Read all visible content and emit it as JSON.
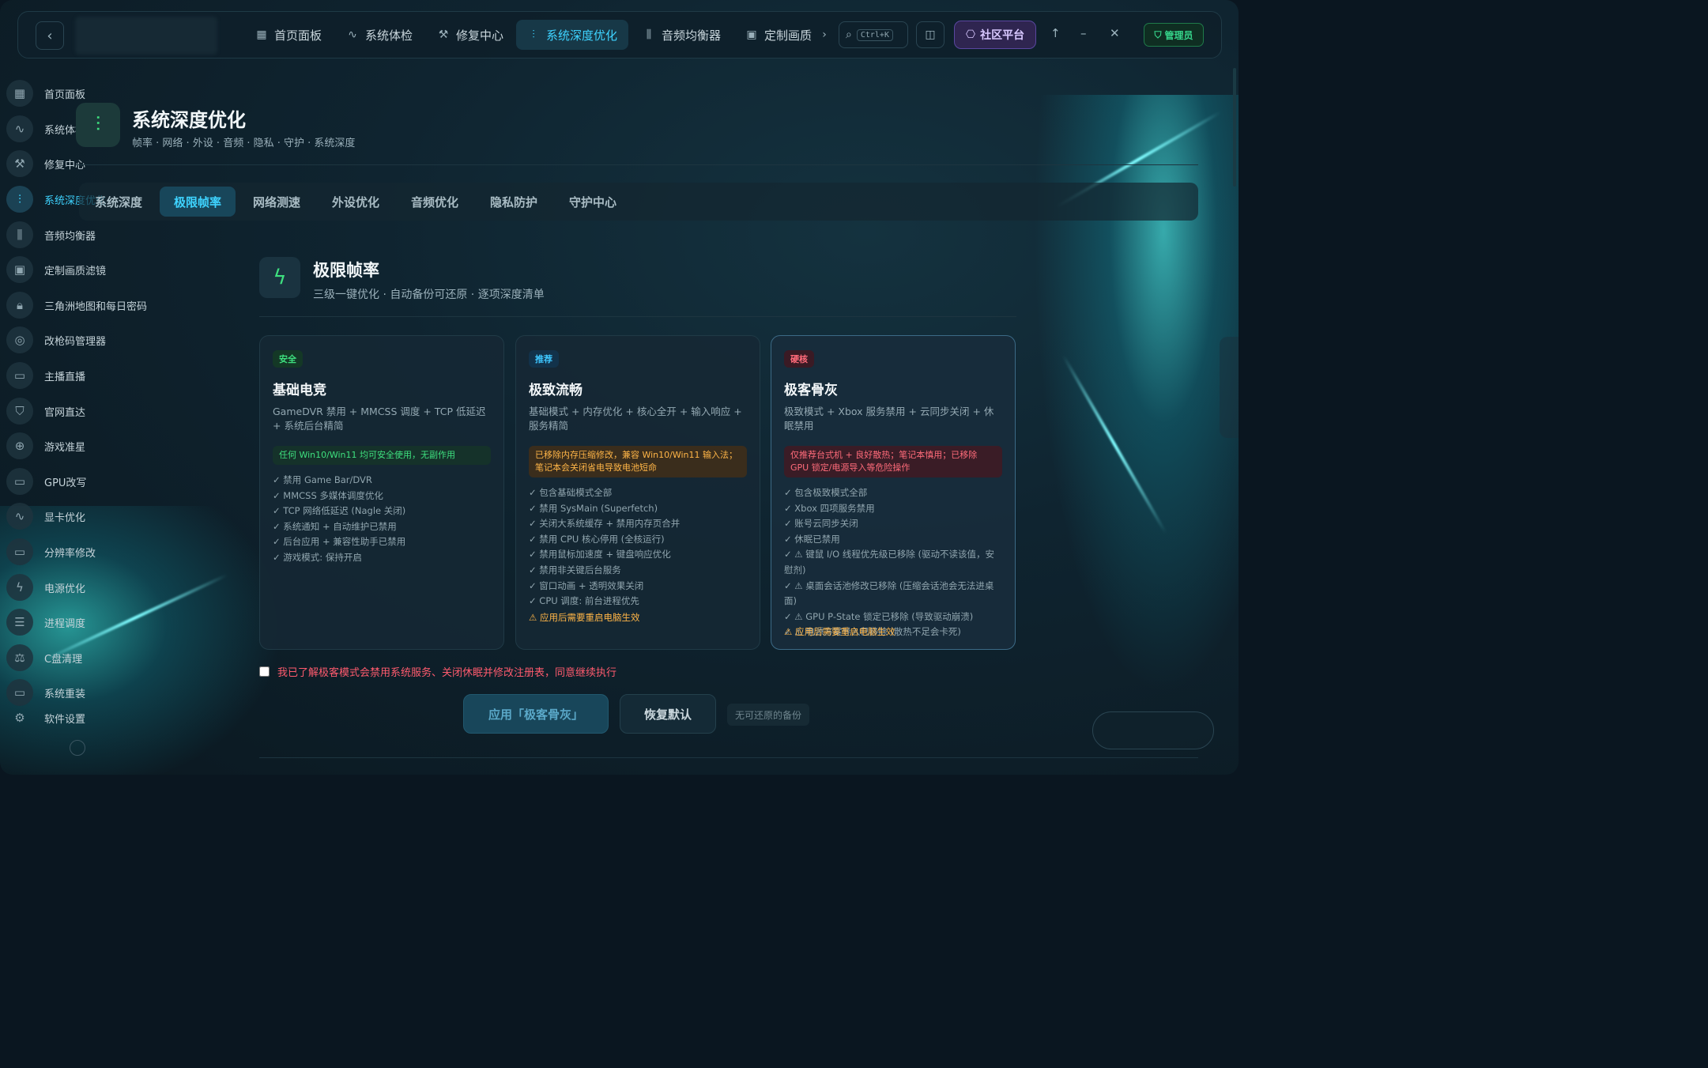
{
  "topbar": {
    "tabs": [
      {
        "label": "首页面板",
        "icon": "grid-icon"
      },
      {
        "label": "系统体检",
        "icon": "pulse-icon"
      },
      {
        "label": "修复中心",
        "icon": "wrench-icon"
      },
      {
        "label": "系统深度优化",
        "icon": "sliders-icon"
      },
      {
        "label": "音频均衡器",
        "icon": "equalizer-icon"
      },
      {
        "label": "定制画质",
        "icon": "image-icon"
      }
    ],
    "search_shortcut": "Ctrl+K",
    "community_label": "社区平台",
    "admin_label": "管理员"
  },
  "sidebar": {
    "items": [
      {
        "label": "首页面板",
        "icon": "grid-icon"
      },
      {
        "label": "系统体检",
        "icon": "pulse-icon"
      },
      {
        "label": "修复中心",
        "icon": "wrench-icon"
      },
      {
        "label": "系统深度优化",
        "icon": "sliders-icon"
      },
      {
        "label": "音频均衡器",
        "icon": "equalizer-icon"
      },
      {
        "label": "定制画质滤镜",
        "icon": "image-icon"
      },
      {
        "label": "三角洲地图和每日密码",
        "icon": "lock-icon"
      },
      {
        "label": "改枪码管理器",
        "icon": "target-icon"
      },
      {
        "label": "主播直播",
        "icon": "video-icon"
      },
      {
        "label": "官网直达",
        "icon": "shield-icon"
      },
      {
        "label": "游戏准星",
        "icon": "crosshair-icon"
      },
      {
        "label": "GPU改写",
        "icon": "monitor-icon"
      },
      {
        "label": "显卡优化",
        "icon": "pulse-icon"
      },
      {
        "label": "分辨率修改",
        "icon": "monitor-icon"
      },
      {
        "label": "电源优化",
        "icon": "bolt-icon"
      },
      {
        "label": "进程调度",
        "icon": "list-icon"
      },
      {
        "label": "C盘清理",
        "icon": "scale-icon"
      },
      {
        "label": "系统重装",
        "icon": "monitor-icon"
      },
      {
        "label": "软件设置",
        "icon": "gear-icon"
      }
    ]
  },
  "header": {
    "title": "系统深度优化",
    "subtitle": "帧率 · 网络 · 外设 · 音频 · 隐私 · 守护 · 系统深度"
  },
  "subtabs": [
    "系统深度",
    "极限帧率",
    "网络测速",
    "外设优化",
    "音频优化",
    "隐私防护",
    "守护中心"
  ],
  "section": {
    "title": "极限帧率",
    "subtitle": "三级一键优化 · 自动备份可还原 · 逐项深度清单"
  },
  "cards": [
    {
      "tag": "安全",
      "title": "基础电竞",
      "desc": "GameDVR 禁用 + MMCSS 调度 + TCP 低延迟 + 系统后台精简",
      "note": "任何 Win10/Win11 均可安全使用，无副作用",
      "items": [
        "✓ 禁用 Game Bar/DVR",
        "✓ MMCSS 多媒体调度优化",
        "✓ TCP 网络低延迟 (Nagle 关闭)",
        "✓ 系统通知 + 自动维护已禁用",
        "✓ 后台应用 + 兼容性助手已禁用",
        "✓ 游戏模式: 保持开启"
      ],
      "warn": ""
    },
    {
      "tag": "推荐",
      "title": "极致流畅",
      "desc": "基础模式 + 内存优化 + 核心全开 + 输入响应 + 服务精简",
      "note": "已移除内存压缩修改，兼容 Win10/Win11 输入法；笔记本会关闭省电导致电池短命",
      "items": [
        "✓ 包含基础模式全部",
        "✓ 禁用 SysMain (Superfetch)",
        "✓ 关闭大系统缓存 + 禁用内存页合并",
        "✓ 禁用 CPU 核心停用 (全核运行)",
        "✓ 禁用鼠标加速度 + 键盘响应优化",
        "✓ 禁用非关键后台服务",
        "✓ 窗口动画 + 透明效果关闭",
        "✓ CPU 调度: 前台进程优先"
      ],
      "warn": "⚠ 应用后需要重启电脑生效"
    },
    {
      "tag": "硬核",
      "title": "极客骨灰",
      "desc": "极致模式 + Xbox 服务禁用 + 云同步关闭 + 休眠禁用",
      "note": "仅推荐台式机 + 良好散热；笔记本慎用；已移除 GPU 锁定/电源导入等危险操作",
      "items": [
        "✓ 包含极致模式全部",
        "✓ Xbox 四项服务禁用",
        "✓ 账号云同步关闭",
        "✓ 休眠已禁用",
        "✓ ⚠ 键鼠 I/O 线程优先级已移除 (驱动不读该值，安慰剂)",
        "✓ ⚠ 桌面会话池修改已移除 (压缩会话池会无法进桌面)",
        "✓ ⚠ GPU P-State 锁定已移除 (导致驱动崩溃)",
        "✓ ⚠ 电源方案导入已移除 (散热不足会卡死)"
      ],
      "warn": "⚠ 应用后需要重启电脑生效"
    }
  ],
  "confirm_text": "我已了解极客模式会禁用系统服务、关闭休眠并修改注册表，同意继续执行",
  "actions": {
    "apply": "应用「极客骨灰」",
    "reset": "恢复默认",
    "no_backup": "无可还原的备份"
  },
  "colors": {
    "accent": "#3ed3ff",
    "green": "#3ee07f",
    "amber": "#ffb547",
    "red": "#ff6b7a",
    "community": "#5a47a0"
  }
}
